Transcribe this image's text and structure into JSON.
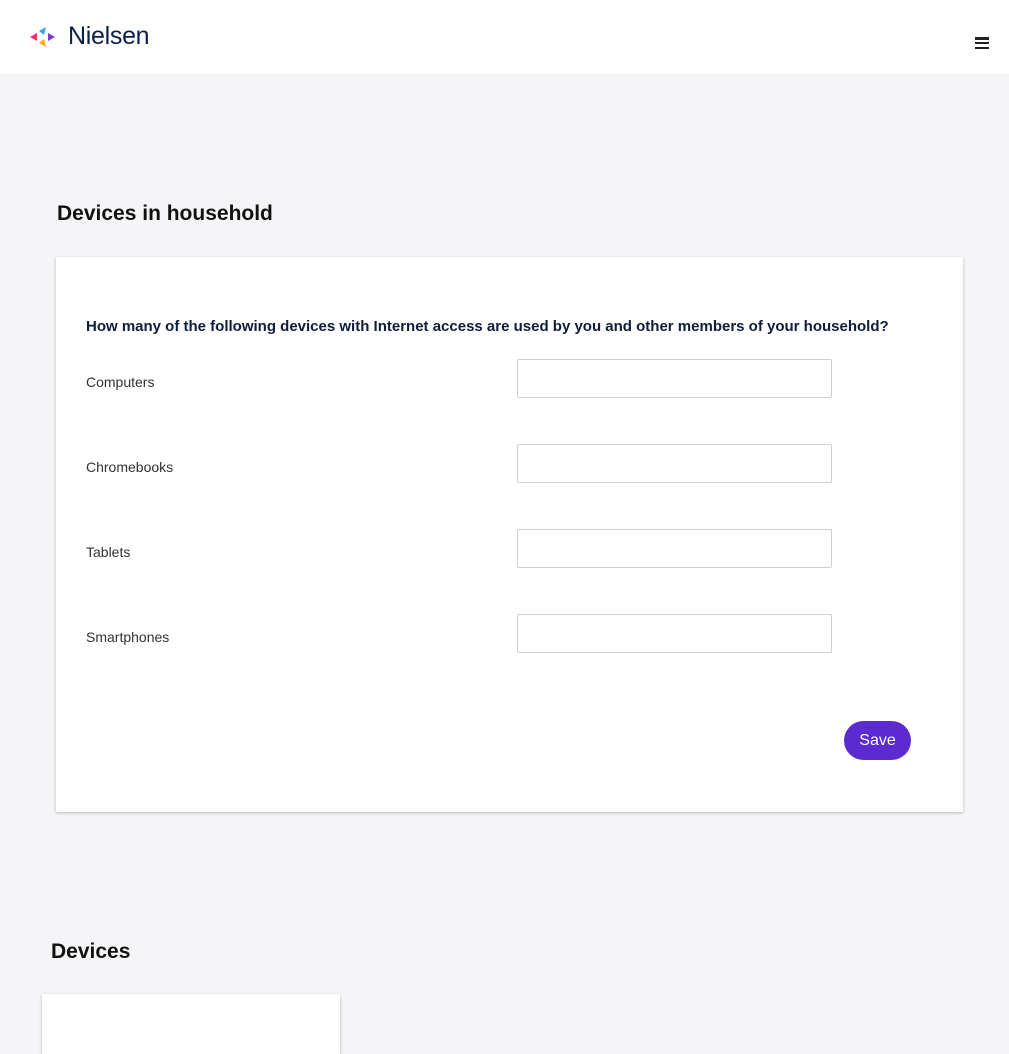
{
  "header": {
    "logo_text": "Nielsen",
    "logo_icon": "nielsen-logo-mark",
    "menu_icon": "hamburger-menu-icon"
  },
  "household_section": {
    "title": "Devices in household",
    "question": "How many of the following devices with Internet access are used by you and other members of your household?",
    "fields": [
      {
        "label": "Computers",
        "value": ""
      },
      {
        "label": "Chromebooks",
        "value": ""
      },
      {
        "label": "Tablets",
        "value": ""
      },
      {
        "label": "Smartphones",
        "value": ""
      }
    ],
    "save_label": "Save"
  },
  "devices_section": {
    "title": "Devices"
  },
  "colors": {
    "accent": "#5b2ad1",
    "brand_text": "#0b1f4b",
    "background": "#f5f5f7"
  }
}
